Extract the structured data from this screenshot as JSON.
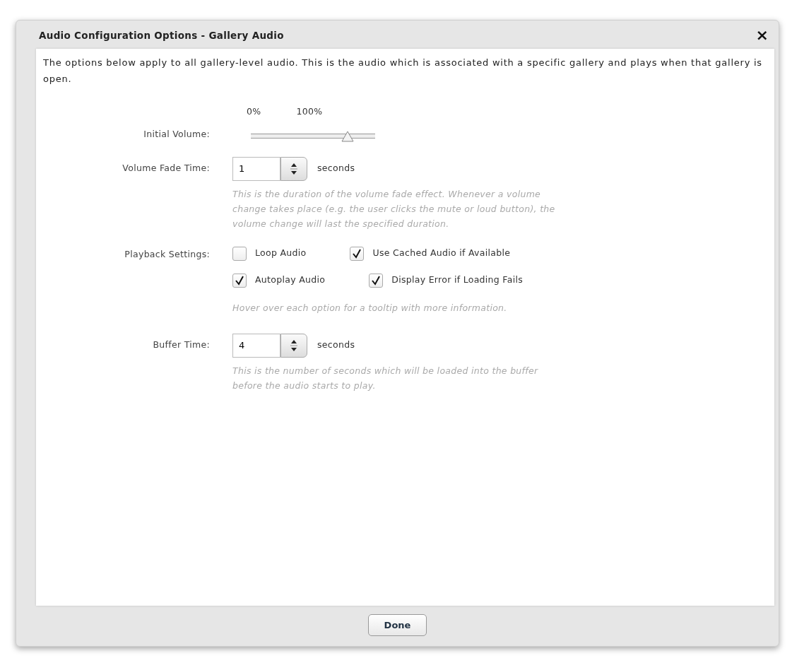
{
  "dialog": {
    "title": "Audio Configuration Options - Gallery Audio",
    "close": "×"
  },
  "intro": "The options below apply to all gallery-level audio.  This is the audio which is associated with a specific gallery and plays when that gallery is open.",
  "initial_volume": {
    "label": "Initial Volume:",
    "min_label": "0%",
    "max_label": "100%",
    "level": 0.78
  },
  "fade_time": {
    "label": "Volume Fade Time:",
    "value": "1",
    "unit": "seconds",
    "help": "This is the duration of the volume fade effect.  Whenever a volume change takes place (e.g. the user clicks the mute or loud button), the volume change will last the specified duration."
  },
  "playback": {
    "label": "Playback Settings:",
    "rows": [
      [
        {
          "label": "Loop Audio",
          "checked": false
        },
        {
          "label": "Use Cached Audio if Available",
          "checked": true
        }
      ],
      [
        {
          "label": "Autoplay Audio",
          "checked": true
        },
        {
          "label": "Display Error if Loading Fails",
          "checked": true
        }
      ]
    ],
    "help": "Hover over each option for a tooltip with more information."
  },
  "buffer_time": {
    "label": "Buffer Time:",
    "value": "4",
    "unit": "seconds",
    "help": "This is the number of seconds which will be loaded into the buffer before the audio starts to play."
  },
  "buttons": [
    "Done"
  ]
}
